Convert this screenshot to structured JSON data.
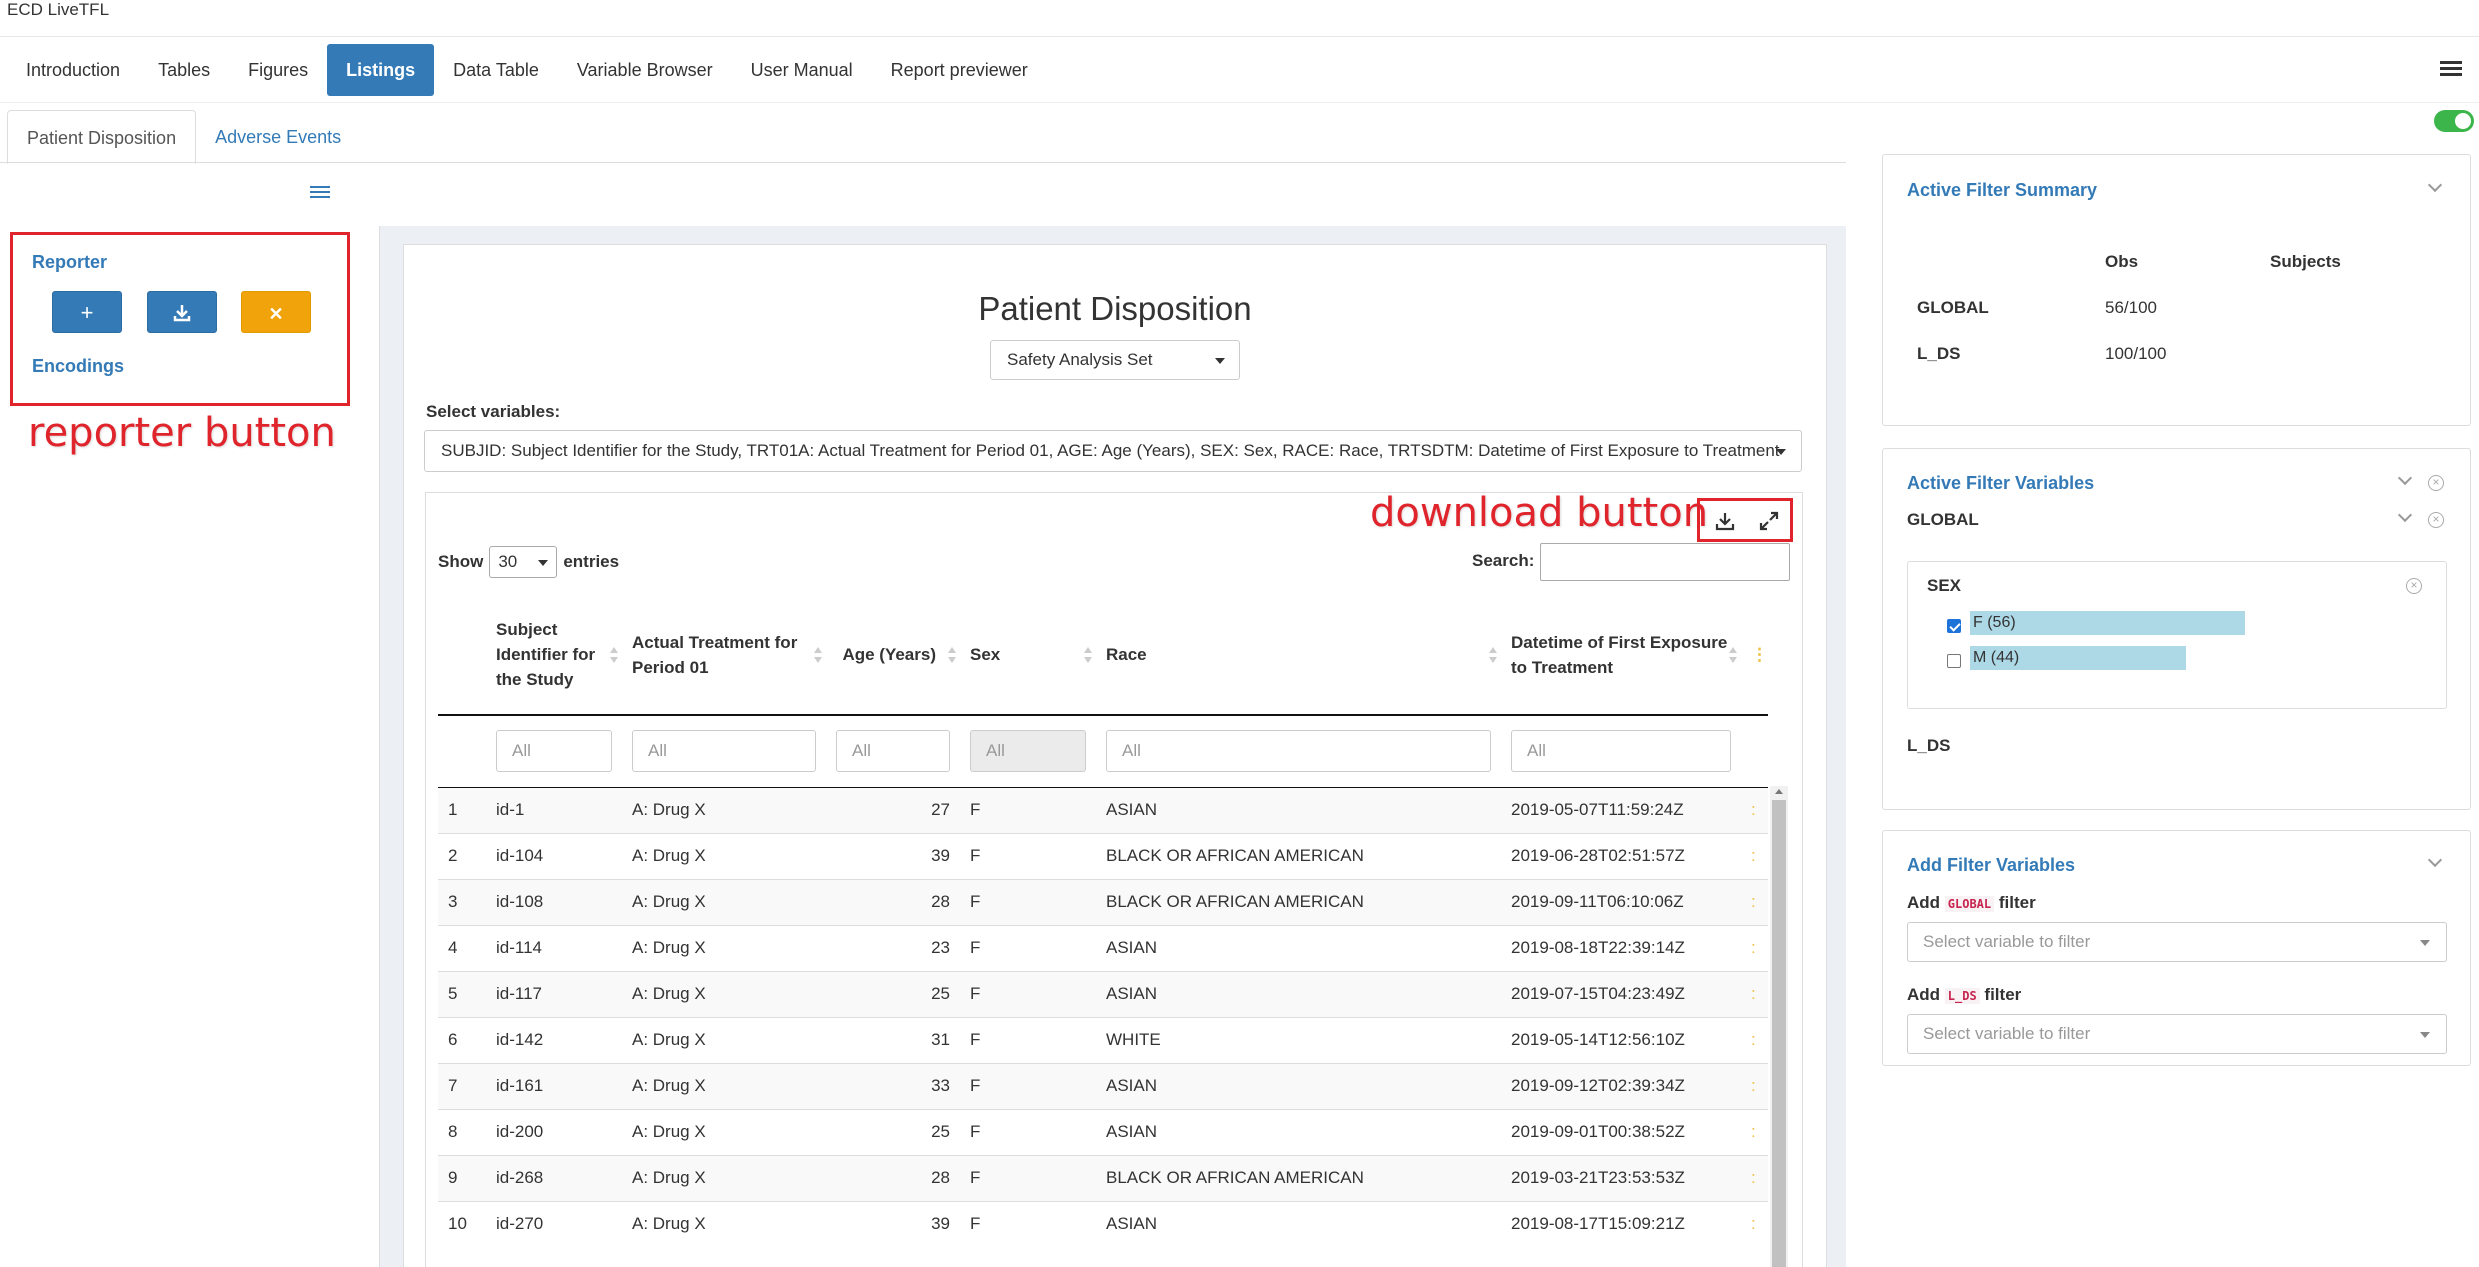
{
  "app": {
    "title": "ECD LiveTFL"
  },
  "nav": {
    "items": [
      {
        "label": "Introduction"
      },
      {
        "label": "Tables"
      },
      {
        "label": "Figures"
      },
      {
        "label": "Listings"
      },
      {
        "label": "Data Table"
      },
      {
        "label": "Variable Browser"
      },
      {
        "label": "User Manual"
      },
      {
        "label": "Report previewer"
      }
    ],
    "active": "Listings"
  },
  "subtabs": {
    "items": [
      {
        "label": "Patient Disposition"
      },
      {
        "label": "Adverse Events"
      }
    ],
    "active": "Patient Disposition"
  },
  "reporter": {
    "title": "Reporter",
    "add_icon": "plus-icon",
    "download_icon": "download-icon",
    "reset_icon": "x-icon",
    "encodings": "Encodings",
    "annotation": "reporter button"
  },
  "main": {
    "title": "Patient Disposition",
    "dataset": "Safety Analysis Set",
    "select_variables_label": "Select variables:",
    "variables_value": "SUBJID: Subject Identifier for the Study, TRT01A: Actual Treatment for Period 01, AGE: Age (Years), SEX: Sex, RACE: Race, TRTSDTM: Datetime of First Exposure to Treatment",
    "download_annotation": "download button",
    "show_label": "Show",
    "entries_value": "30",
    "entries_label": "entries",
    "search_label": "Search:",
    "columns": [
      "",
      "Subject Identifier for the Study",
      "Actual Treatment for Period 01",
      "Age (Years)",
      "Sex",
      "Race",
      "Datetime of First Exposure to Treatment"
    ],
    "filter_placeholders": [
      "All",
      "All",
      "All",
      "All",
      "All",
      "All"
    ],
    "rows": [
      [
        "1",
        "id-1",
        "A: Drug X",
        "27",
        "F",
        "ASIAN",
        "2019-05-07T11:59:24Z"
      ],
      [
        "2",
        "id-104",
        "A: Drug X",
        "39",
        "F",
        "BLACK OR AFRICAN AMERICAN",
        "2019-06-28T02:51:57Z"
      ],
      [
        "3",
        "id-108",
        "A: Drug X",
        "28",
        "F",
        "BLACK OR AFRICAN AMERICAN",
        "2019-09-11T06:10:06Z"
      ],
      [
        "4",
        "id-114",
        "A: Drug X",
        "23",
        "F",
        "ASIAN",
        "2019-08-18T22:39:14Z"
      ],
      [
        "5",
        "id-117",
        "A: Drug X",
        "25",
        "F",
        "ASIAN",
        "2019-07-15T04:23:49Z"
      ],
      [
        "6",
        "id-142",
        "A: Drug X",
        "31",
        "F",
        "WHITE",
        "2019-05-14T12:56:10Z"
      ],
      [
        "7",
        "id-161",
        "A: Drug X",
        "33",
        "F",
        "ASIAN",
        "2019-09-12T02:39:34Z"
      ],
      [
        "8",
        "id-200",
        "A: Drug X",
        "25",
        "F",
        "ASIAN",
        "2019-09-01T00:38:52Z"
      ],
      [
        "9",
        "id-268",
        "A: Drug X",
        "28",
        "F",
        "BLACK OR AFRICAN AMERICAN",
        "2019-03-21T23:53:53Z"
      ],
      [
        "10",
        "id-270",
        "A: Drug X",
        "39",
        "F",
        "ASIAN",
        "2019-08-17T15:09:21Z"
      ]
    ]
  },
  "filter_summary": {
    "title": "Active Filter Summary",
    "col_obs": "Obs",
    "col_subjects": "Subjects",
    "rows": [
      {
        "name": "GLOBAL",
        "obs": "56/100"
      },
      {
        "name": "L_DS",
        "obs": "100/100"
      }
    ]
  },
  "active_filters": {
    "title": "Active Filter Variables",
    "global_label": "GLOBAL",
    "var_name": "SEX",
    "options": [
      {
        "label": "F (56)",
        "checked": true,
        "fraction": 0.56
      },
      {
        "label": "M (44)",
        "checked": false,
        "fraction": 0.44
      }
    ],
    "lds_label": "L_DS"
  },
  "add_filters": {
    "title": "Add Filter Variables",
    "add_word": "Add",
    "filter_word": "filter",
    "global_code": "GLOBAL",
    "lds_code": "L_DS",
    "placeholder": "Select variable to filter"
  },
  "colors": {
    "primary": "#337ab7",
    "warning": "#f0a30a",
    "annotation": "#e0242c",
    "toggle_on": "#3cb64a",
    "filter_bar": "#add8e6"
  }
}
